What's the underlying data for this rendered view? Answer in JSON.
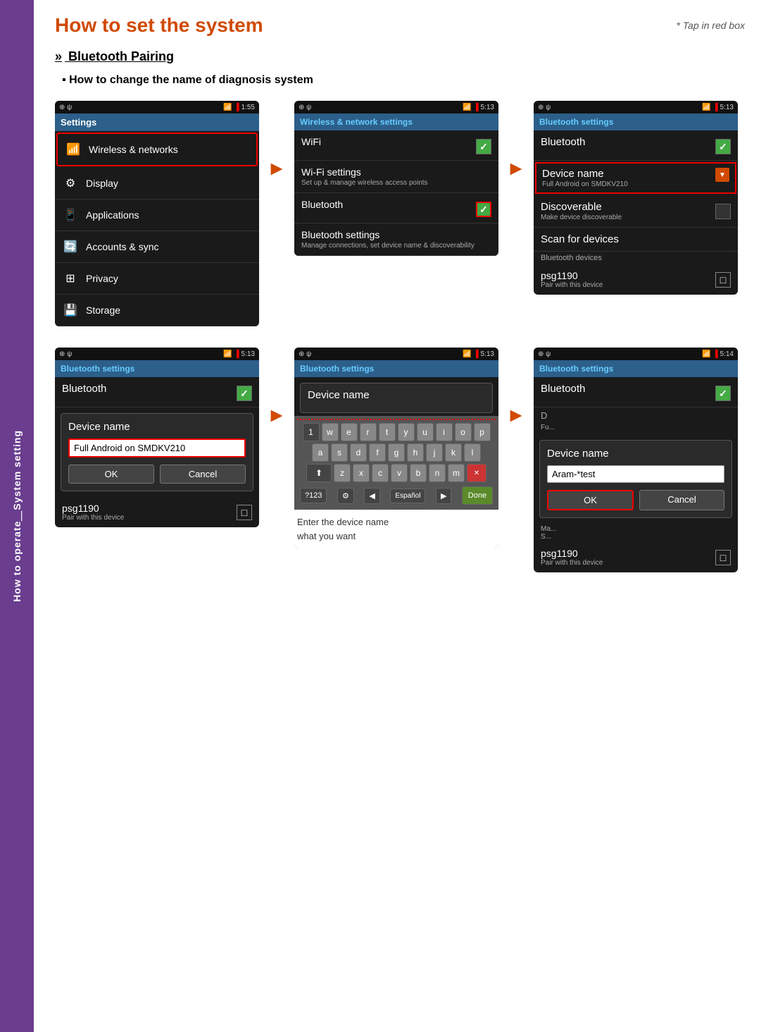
{
  "sidebar": {
    "text": "How to operate＿System setting"
  },
  "header": {
    "title": "How to set the system",
    "tap_note": "* Tap in red box"
  },
  "section": {
    "title": "Bluetooth Pairing",
    "subtitle": "How to change the name of diagnosis system"
  },
  "screen1": {
    "status": {
      "left": "⊕ ψ",
      "time": "1:55",
      "bat": ""
    },
    "header": "Settings",
    "items": [
      {
        "icon": "📶",
        "label": "Wireless & networks",
        "highlighted": true
      },
      {
        "icon": "⚙",
        "label": "Display",
        "highlighted": false
      },
      {
        "icon": "📱",
        "label": "Applications",
        "highlighted": false
      },
      {
        "icon": "🔄",
        "label": "Accounts & sync",
        "highlighted": false
      },
      {
        "icon": "⊞",
        "label": "Privacy",
        "highlighted": false
      },
      {
        "icon": "💾",
        "label": "Storage",
        "highlighted": false
      }
    ]
  },
  "screen2": {
    "status": {
      "left": "⊕ ψ",
      "time": "5:13"
    },
    "header": "Wireless & network settings",
    "items": [
      {
        "title": "WiFi",
        "sub": "",
        "checked": true,
        "red_border": false
      },
      {
        "title": "Wi-Fi settings",
        "sub": "Set up & manage wireless access points",
        "checked": false,
        "no_check": true,
        "red_border": false
      },
      {
        "title": "Bluetooth",
        "sub": "",
        "checked": true,
        "red_border": true
      },
      {
        "title": "Bluetooth settings",
        "sub": "Manage connections, set device name & discoverability",
        "checked": false,
        "no_check": true,
        "red_border": false
      }
    ]
  },
  "screen3": {
    "status": {
      "left": "⊕ ψ",
      "time": "5:13"
    },
    "header": "Bluetooth settings",
    "bluetooth_label": "Bluetooth",
    "bt_checked": true,
    "items": [
      {
        "title": "Device name",
        "sub": "Full Android on SMDKV210",
        "red_border": true,
        "has_dropdown": true
      },
      {
        "title": "Discoverable",
        "sub": "Make device discoverable",
        "red_border": false,
        "has_check": true
      },
      {
        "title": "Scan for devices",
        "sub": "",
        "red_border": false,
        "has_check": false
      }
    ],
    "devices_label": "Bluetooth devices",
    "device": {
      "name": "psg1190",
      "sub": "Pair with this device"
    }
  },
  "screen4": {
    "status": {
      "left": "⊕ ψ",
      "time": "5:13"
    },
    "header": "Bluetooth settings",
    "bluetooth_label": "Bluetooth",
    "bt_checked": true,
    "dialog": {
      "title": "Device name",
      "input_value": "Full Android on SMDKV210",
      "input_red_border": true,
      "ok": "OK",
      "cancel": "Cancel"
    },
    "device": {
      "name": "psg1190",
      "sub": "Pair with this device"
    }
  },
  "screen5": {
    "status": {
      "left": "⊕ ψ",
      "time": "5:13"
    },
    "header": "Bluetooth settings",
    "dialog": {
      "title": "Device name"
    },
    "keyboard": {
      "row1": [
        "1",
        "w",
        "e",
        "r",
        "t",
        "y",
        "u",
        "i",
        "o",
        "p"
      ],
      "row2": [
        "a",
        "s",
        "d",
        "f",
        "g",
        "h",
        "j",
        "k",
        "l"
      ],
      "row3": [
        "⬆",
        "z",
        "x",
        "c",
        "v",
        "b",
        "n",
        "m",
        "✕"
      ],
      "bottom": [
        "?123",
        "⚙",
        "◀",
        "Español",
        "▶",
        "Done"
      ]
    },
    "caption": "Enter the device name\nwhat you want"
  },
  "screen6": {
    "status": {
      "left": "⊕ ψ",
      "time": "5:14"
    },
    "header": "Bluetooth settings",
    "bluetooth_label": "Bluetooth",
    "bt_checked": true,
    "dialog": {
      "title": "Device name",
      "input_value": "Aram-*test",
      "ok": "OK",
      "cancel": "Cancel",
      "ok_red_border": true
    },
    "device": {
      "name": "psg1190",
      "sub": "Pair with this device"
    }
  }
}
